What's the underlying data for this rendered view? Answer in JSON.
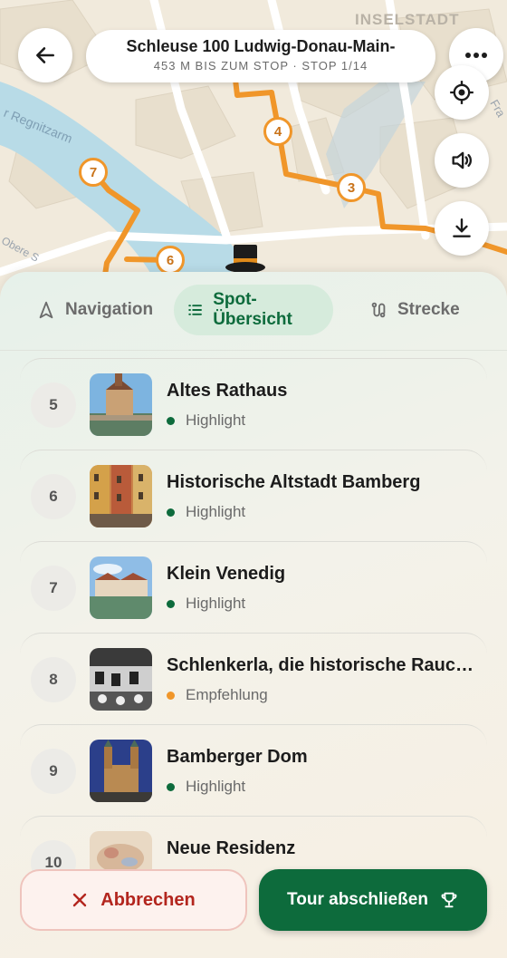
{
  "map": {
    "district_label": "INSELSTADT",
    "river_label": "r Regnitzarm",
    "street_label": "Fra",
    "street_label2": "Obere S",
    "markers": [
      "4",
      "3",
      "7",
      "6"
    ]
  },
  "header": {
    "title": "Schleuse 100 Ludwig-Donau-Main-",
    "subtitle": "453 M BIS ZUM STOP · STOP 1/14"
  },
  "tabs": [
    {
      "label": "Navigation",
      "icon": "navigation-arrow-icon",
      "active": false
    },
    {
      "label": "Spot-Übersicht",
      "icon": "list-icon",
      "active": true
    },
    {
      "label": "Strecke",
      "icon": "route-icon",
      "active": false
    }
  ],
  "spots": [
    {
      "number": "5",
      "title": "Altes Rathaus",
      "tag": "Highlight",
      "tag_color": "#0d6b3c"
    },
    {
      "number": "6",
      "title": "Historische Altstadt Bamberg",
      "tag": "Highlight",
      "tag_color": "#0d6b3c"
    },
    {
      "number": "7",
      "title": "Klein Venedig",
      "tag": "Highlight",
      "tag_color": "#0d6b3c"
    },
    {
      "number": "8",
      "title": "Schlenkerla, die historische Rauchbierbrauerei",
      "tag": "Empfehlung",
      "tag_color": "#f0962a"
    },
    {
      "number": "9",
      "title": "Bamberger Dom",
      "tag": "Highlight",
      "tag_color": "#0d6b3c"
    },
    {
      "number": "10",
      "title": "Neue Residenz",
      "tag": "",
      "tag_color": "#0d6b3c"
    }
  ],
  "actions": {
    "cancel_label": "Abbrechen",
    "finish_label": "Tour abschließen"
  },
  "colors": {
    "accent_green": "#0d6b3c",
    "route_orange": "#f0962a",
    "cancel_red": "#b3261e"
  }
}
